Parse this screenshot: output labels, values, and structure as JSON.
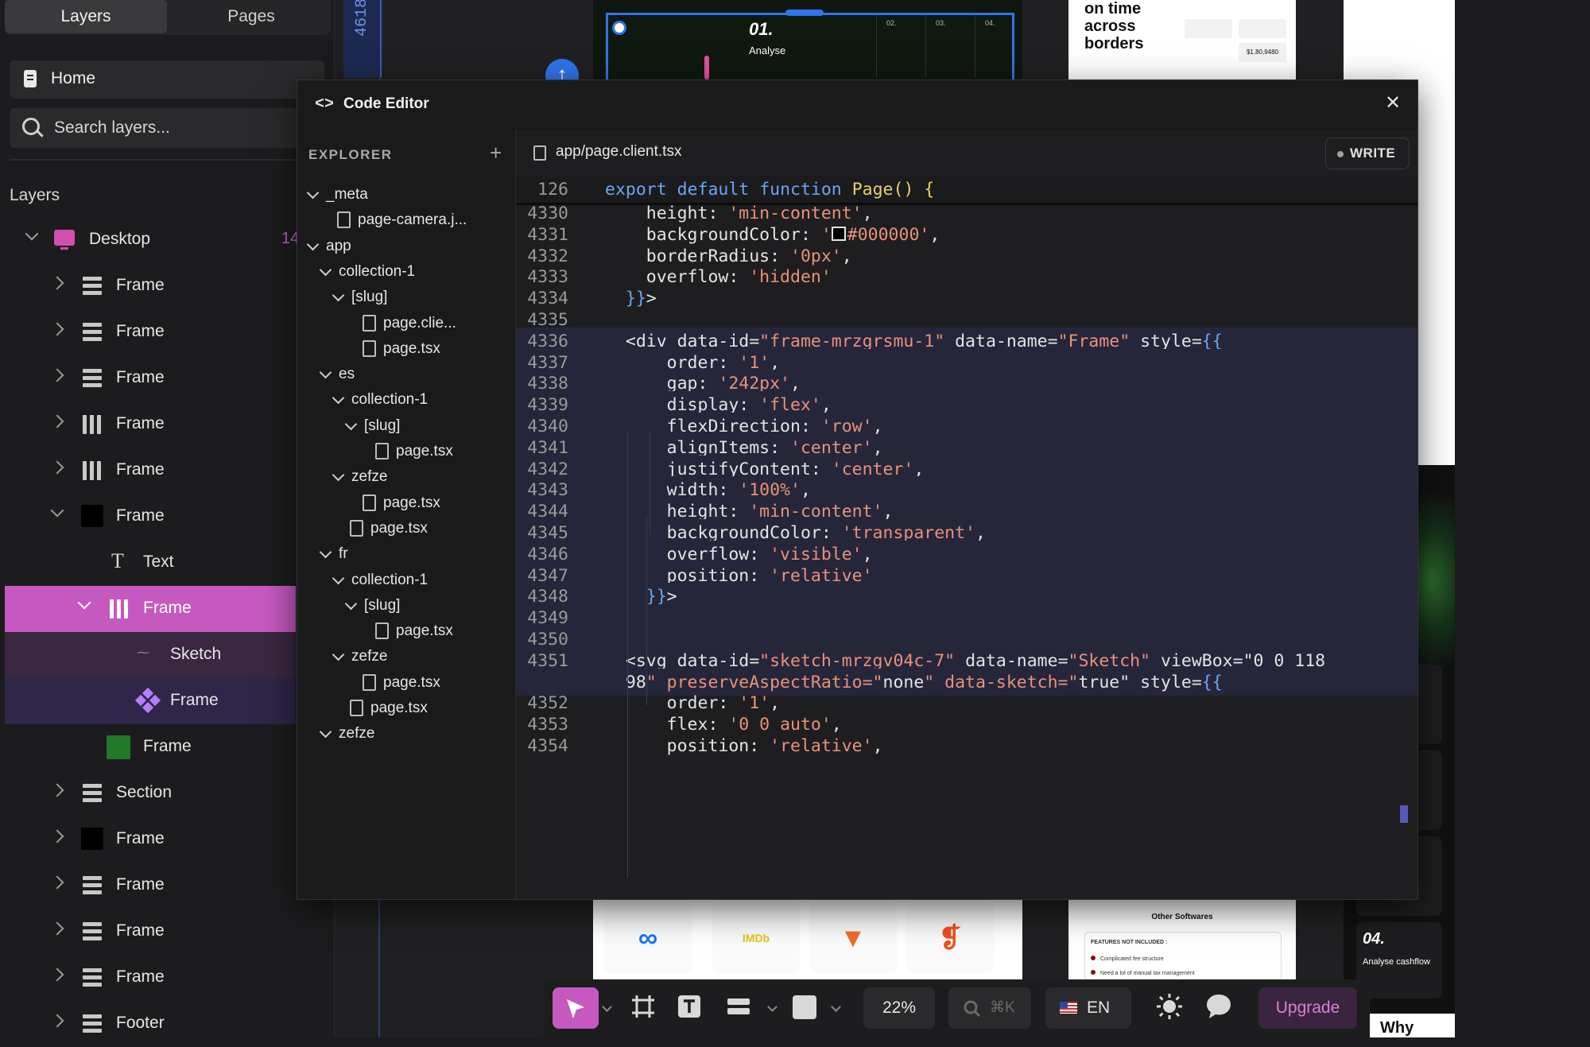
{
  "left_panel": {
    "tabs": [
      {
        "label": "Layers"
      },
      {
        "label": "Pages"
      }
    ],
    "page": "Home",
    "search_placeholder": "Search layers...",
    "heading": "Layers",
    "desktop_count": "14",
    "layers": [
      {
        "name": "Desktop"
      },
      {
        "name": "Frame"
      },
      {
        "name": "Frame"
      },
      {
        "name": "Frame"
      },
      {
        "name": "Frame"
      },
      {
        "name": "Frame"
      },
      {
        "name": "Frame"
      },
      {
        "name": "Text"
      },
      {
        "name": "Frame"
      },
      {
        "name": "Sketch"
      },
      {
        "name": "Frame"
      },
      {
        "name": "Frame"
      },
      {
        "name": "Section"
      },
      {
        "name": "Frame"
      },
      {
        "name": "Frame"
      },
      {
        "name": "Frame"
      },
      {
        "name": "Frame"
      },
      {
        "name": "Footer"
      }
    ]
  },
  "canvas": {
    "ruler_value": "4618",
    "preview_step": "01.",
    "preview_step_label": "Analyse",
    "preview_cols": [
      "02.",
      "03.",
      "04."
    ],
    "card_top_title": "on time across borders",
    "card_top_amount": "$1,80,9480",
    "card_bottom_title": "Other Softwares",
    "card_bottom_sub": "FEATURES NOT INCLUDED :",
    "card_bottom_items": [
      "Complicated fee structure",
      "Need a lot of manual tax management"
    ],
    "logos": [
      "∞",
      "IMDb",
      "▼",
      "❡"
    ],
    "side_step": "04.",
    "side_step_label": "Analyse cashflow",
    "why": "Why"
  },
  "editor": {
    "title": "Code Editor",
    "explorer_heading": "EXPLORER",
    "file_tab": "app/page.client.tsx",
    "write_label": "WRITE",
    "tree": [
      {
        "name": "_meta"
      },
      {
        "name": "page-camera.j..."
      },
      {
        "name": "app"
      },
      {
        "name": "collection-1"
      },
      {
        "name": "[slug]"
      },
      {
        "name": "page.clie..."
      },
      {
        "name": "page.tsx"
      },
      {
        "name": "es"
      },
      {
        "name": "collection-1"
      },
      {
        "name": "[slug]"
      },
      {
        "name": "page.tsx"
      },
      {
        "name": "zefze"
      },
      {
        "name": "page.tsx"
      },
      {
        "name": "page.tsx"
      },
      {
        "name": "fr"
      },
      {
        "name": "collection-1"
      },
      {
        "name": "[slug]"
      },
      {
        "name": "page.tsx"
      },
      {
        "name": "zefze"
      },
      {
        "name": "page.tsx"
      },
      {
        "name": "page.tsx"
      },
      {
        "name": "zefze"
      }
    ],
    "sticky_line": {
      "num": "126",
      "code": "export default function Page() {"
    },
    "lines": [
      {
        "num": "4330",
        "code": "    height: 'min-content',"
      },
      {
        "num": "4331",
        "code": "    backgroundColor: '#000000',"
      },
      {
        "num": "4332",
        "code": "    borderRadius: '0px',"
      },
      {
        "num": "4333",
        "code": "    overflow: 'hidden'"
      },
      {
        "num": "4334",
        "code": "  }}>"
      },
      {
        "num": "4335",
        "code": ""
      },
      {
        "num": "4336",
        "code": "  <div data-id=\"frame-mrzgrsmu-1\" data-name=\"Frame\" style={{"
      },
      {
        "num": "4337",
        "code": "      order: '1',"
      },
      {
        "num": "4338",
        "code": "      gap: '242px',"
      },
      {
        "num": "4339",
        "code": "      display: 'flex',"
      },
      {
        "num": "4340",
        "code": "      flexDirection: 'row',"
      },
      {
        "num": "4341",
        "code": "      alignItems: 'center',"
      },
      {
        "num": "4342",
        "code": "      justifyContent: 'center',"
      },
      {
        "num": "4343",
        "code": "      width: '100%',"
      },
      {
        "num": "4344",
        "code": "      height: 'min-content',"
      },
      {
        "num": "4345",
        "code": "      backgroundColor: 'transparent',"
      },
      {
        "num": "4346",
        "code": "      overflow: 'visible',"
      },
      {
        "num": "4347",
        "code": "      position: 'relative'"
      },
      {
        "num": "4348",
        "code": "    }}>"
      },
      {
        "num": "4349",
        "code": ""
      },
      {
        "num": "4350",
        "code": ""
      },
      {
        "num": "4351",
        "code": "  <svg data-id=\"sketch-mrzgv04c-7\" data-name=\"Sketch\" viewBox=\"0 0 118"
      },
      {
        "num": "",
        "code": "  98\" preserveAspectRatio=\"none\" data-sketch=\"true\" style={{"
      },
      {
        "num": "4352",
        "code": "      order: '1',"
      },
      {
        "num": "4353",
        "code": "      flex: '0 0 auto',"
      },
      {
        "num": "4354",
        "code": "      position: 'relative',"
      }
    ]
  },
  "toolbar": {
    "zoom": "22%",
    "search_shortcut": "⌘K",
    "language": "EN",
    "upgrade": "Upgrade"
  },
  "colors": {
    "accent": "#c659bf",
    "selection_blue": "#2f74ec",
    "code_string": "#e8927a",
    "code_keyword": "#6aa6f2"
  }
}
